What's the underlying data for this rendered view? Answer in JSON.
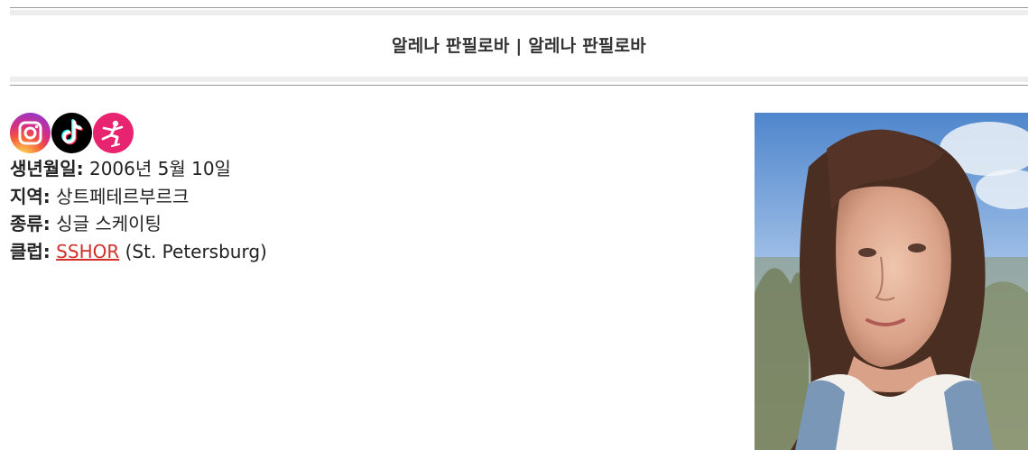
{
  "header": {
    "title": "알레나 판필로바 | 알레나 판필로바"
  },
  "social": [
    {
      "name": "instagram-icon",
      "color": "#d92e7f"
    },
    {
      "name": "tiktok-icon",
      "color": "#000000"
    },
    {
      "name": "skating-icon",
      "color": "#e8236f"
    }
  ],
  "profile": {
    "birth_label": "생년월일:",
    "birth_value": "2006년 5월 10일",
    "region_label": "지역:",
    "region_value": "상트페테르부르크",
    "discipline_label": "종류:",
    "discipline_value": "싱글 스케이팅",
    "club_label": "클럽:",
    "club_link": "SSHOR",
    "club_suffix": "(St. Petersburg)"
  },
  "colors": {
    "link": "#d0312d",
    "band": "#ededed",
    "rule": "#9a9a9a"
  }
}
